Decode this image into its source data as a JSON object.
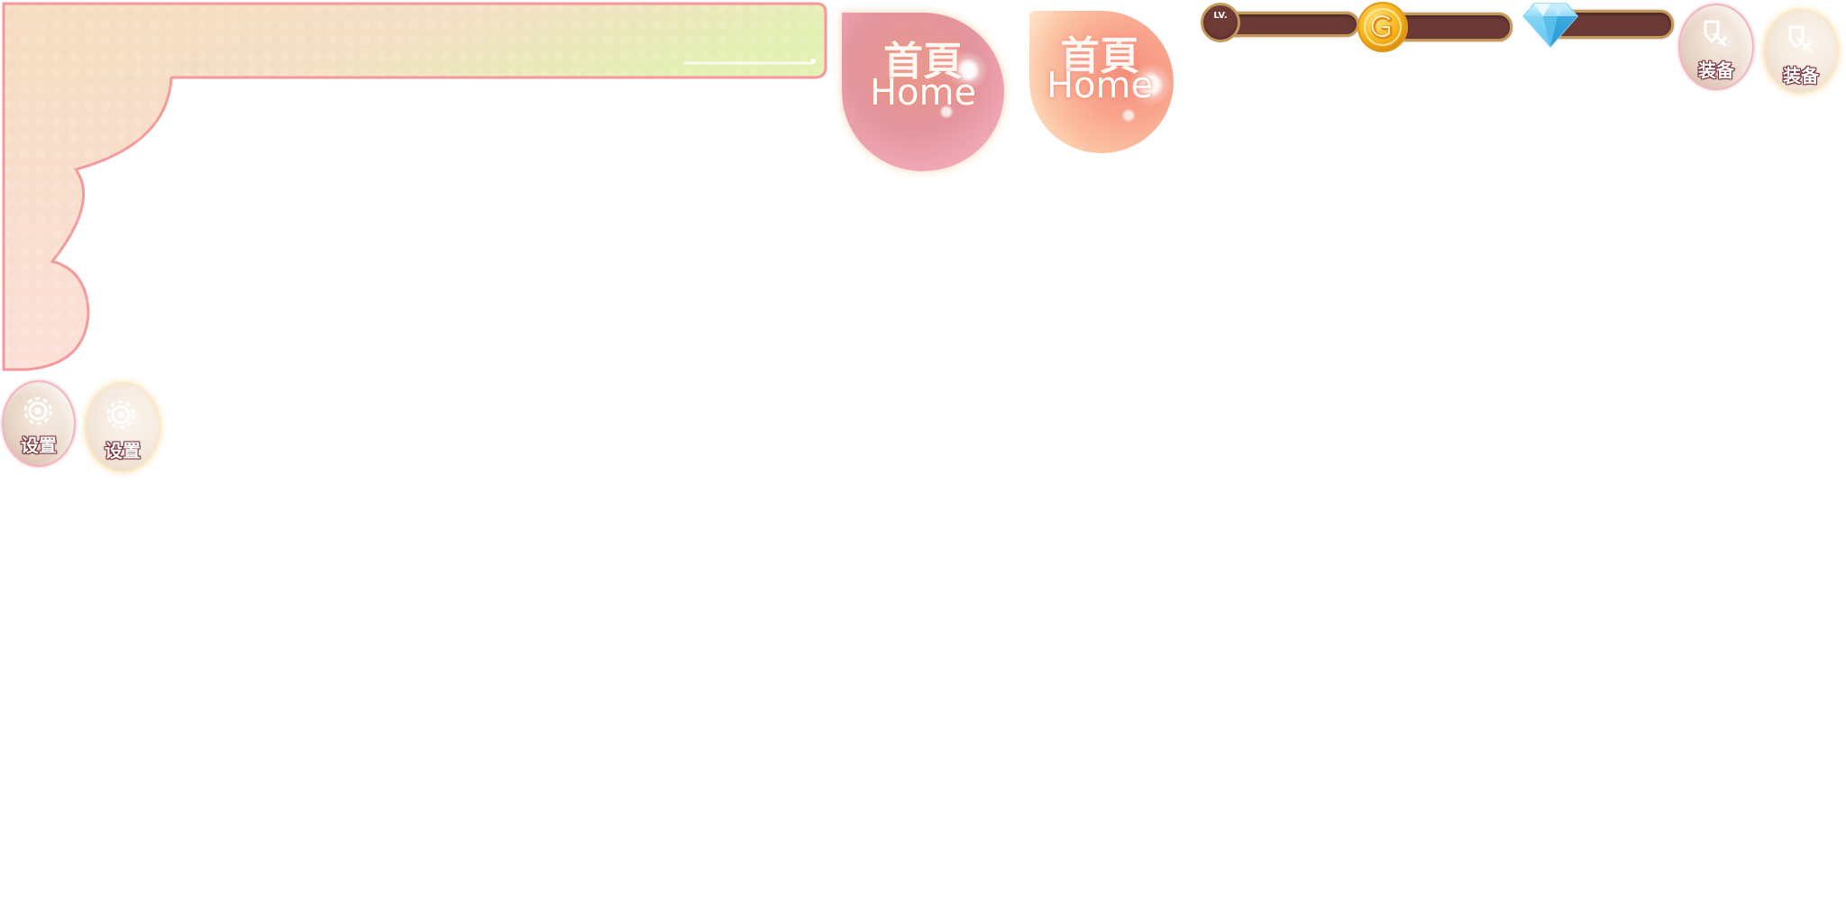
{
  "home_buttons": {
    "pressed": {
      "title_cn": "首頁",
      "title_en": "Home"
    },
    "normal": {
      "title_cn": "首頁",
      "title_en": "Home"
    }
  },
  "resources": {
    "level": {
      "badge_text": "LV.",
      "value": ""
    },
    "gold": {
      "icon": "gold-coin-icon",
      "value": ""
    },
    "gems": {
      "icon": "diamond-icon",
      "value": ""
    }
  },
  "equip_buttons": [
    {
      "label": "装备",
      "icon": "sword-icon",
      "state": "active"
    },
    {
      "label": "装备",
      "icon": "sword-icon",
      "state": "idle"
    }
  ],
  "settings_buttons": [
    {
      "label": "设置",
      "icon": "gear-icon",
      "state": "active"
    },
    {
      "label": "设置",
      "icon": "gear-icon",
      "state": "idle"
    }
  ],
  "colors": {
    "frame_gradient_start": "#f6dcc0",
    "frame_gradient_end": "#e6f0b6",
    "frame_border": "#f49a9c",
    "bar_fill": "#6b3a37",
    "bar_border": "#c49a5a"
  }
}
